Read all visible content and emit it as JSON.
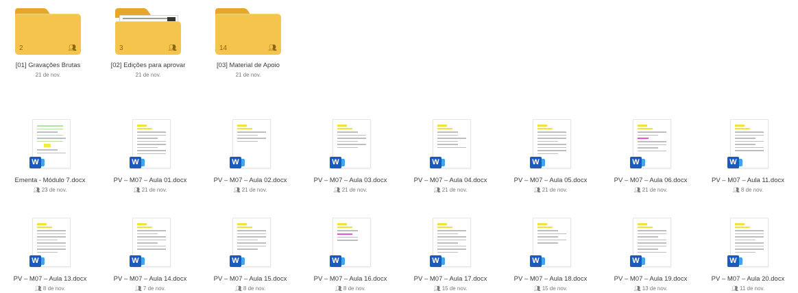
{
  "folders": [
    {
      "name": "[01] Gravações Brutas",
      "date": "21 de nov.",
      "count": "2",
      "icon": "shared-folder-icon"
    },
    {
      "name": "[02] Edições para aprovar",
      "date": "21 de nov.",
      "count": "3",
      "icon": "shared-folder-icon"
    },
    {
      "name": "[03] Material de Apoio",
      "date": "21 de nov.",
      "count": "14",
      "icon": "shared-folder-icon"
    }
  ],
  "files": [
    {
      "name": "Ementa - Módulo 7.docx",
      "date": "23 de nov.",
      "icon": "word-doc-icon"
    },
    {
      "name": "PV – M07 – Aula 01.docx",
      "date": "21 de nov.",
      "icon": "word-doc-icon"
    },
    {
      "name": "PV – M07 – Aula 02.docx",
      "date": "21 de nov.",
      "icon": "word-doc-icon"
    },
    {
      "name": "PV – M07 – Aula 03.docx",
      "date": "21 de nov.",
      "icon": "word-doc-icon"
    },
    {
      "name": "PV – M07 – Aula 04.docx",
      "date": "21 de nov.",
      "icon": "word-doc-icon"
    },
    {
      "name": "PV – M07 – Aula 05.docx",
      "date": "21 de nov.",
      "icon": "word-doc-icon"
    },
    {
      "name": "PV – M07 – Aula 06.docx",
      "date": "21 de nov.",
      "icon": "word-doc-icon"
    },
    {
      "name": "PV – M07 – Aula 11.docx",
      "date": "8 de nov.",
      "icon": "word-doc-icon"
    },
    {
      "name": "PV – M07 – Aula 13.docx",
      "date": "8 de nov.",
      "icon": "word-doc-icon"
    },
    {
      "name": "PV – M07 – Aula 14.docx",
      "date": "7 de nov.",
      "icon": "word-doc-icon"
    },
    {
      "name": "PV – M07 – Aula 15.docx",
      "date": "8 de nov.",
      "icon": "word-doc-icon"
    },
    {
      "name": "PV – M07 – Aula 16.docx",
      "date": "8 de nov.",
      "icon": "word-doc-icon"
    },
    {
      "name": "PV – M07 – Aula 17.docx",
      "date": "15 de nov.",
      "icon": "word-doc-icon"
    },
    {
      "name": "PV – M07 – Aula 18.docx",
      "date": "15 de nov.",
      "icon": "word-doc-icon"
    },
    {
      "name": "PV – M07 – Aula 19.docx",
      "date": "13 de nov.",
      "icon": "word-doc-icon"
    },
    {
      "name": "PV – M07 – Aula 20.docx",
      "date": "11 de nov.",
      "icon": "word-doc-icon"
    }
  ],
  "colors": {
    "folder": "#f5c44c",
    "folder_tab": "#e8a628",
    "word": "#185abd",
    "highlight": "#f2e13a"
  }
}
